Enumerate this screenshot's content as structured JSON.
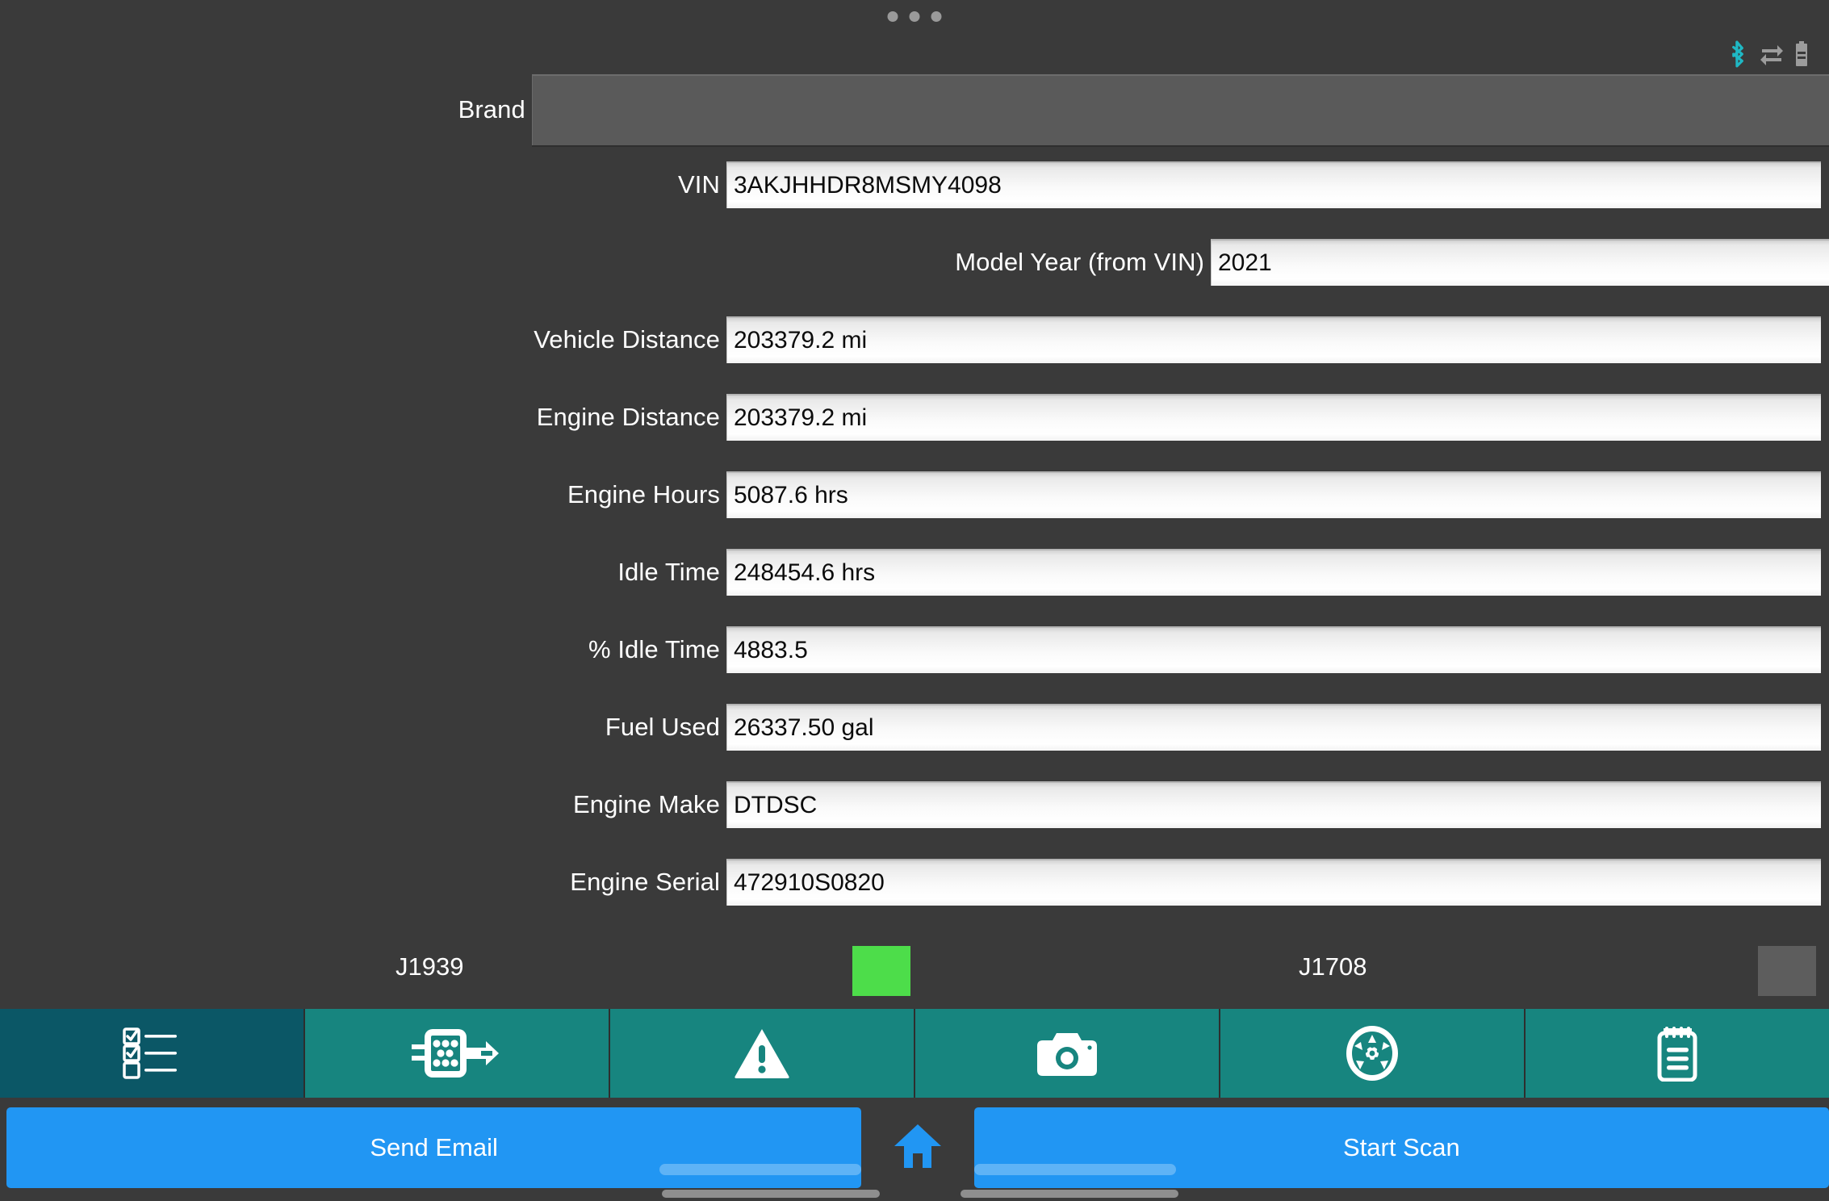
{
  "statusbar": {
    "dots_count": 3,
    "icons": [
      {
        "name": "bluetooth-icon",
        "color": "#1fb8c4"
      },
      {
        "name": "data-transfer-icon",
        "color": "#9c9c9c"
      },
      {
        "name": "battery-icon",
        "color": "#9c9c9c"
      }
    ]
  },
  "form": {
    "rows": [
      {
        "label": "Brand",
        "value": "",
        "type": "dropdown"
      },
      {
        "label": "VIN",
        "value": "3AKJHHDR8MSMY4098",
        "type": "text"
      },
      {
        "label": "Model Year (from VIN)",
        "value": "2021",
        "type": "text"
      },
      {
        "label": "Vehicle Distance",
        "value": "203379.2 mi",
        "type": "text"
      },
      {
        "label": "Engine Distance",
        "value": "203379.2 mi",
        "type": "text"
      },
      {
        "label": "Engine Hours",
        "value": "5087.6 hrs",
        "type": "text"
      },
      {
        "label": "Idle Time",
        "value": "248454.6 hrs",
        "type": "text"
      },
      {
        "label": "% Idle Time",
        "value": "4883.5",
        "type": "text"
      },
      {
        "label": "Fuel Used",
        "value": "26337.50 gal",
        "type": "text"
      },
      {
        "label": "Engine Make",
        "value": "DTDSC",
        "type": "text"
      },
      {
        "label": "Engine Serial",
        "value": "472910S0820",
        "type": "text"
      }
    ]
  },
  "protocols": [
    {
      "label": "J1939",
      "status": "active",
      "color": "#4ddd4a"
    },
    {
      "label": "J1708",
      "status": "inactive",
      "color": "#5d5d5d"
    }
  ],
  "tabs": [
    {
      "name": "checklist",
      "icon": "checklist-icon",
      "selected": true
    },
    {
      "name": "connector",
      "icon": "connector-plug-icon",
      "selected": false
    },
    {
      "name": "faults",
      "icon": "warning-triangle-icon",
      "selected": false
    },
    {
      "name": "camera",
      "icon": "camera-icon",
      "selected": false
    },
    {
      "name": "wheels",
      "icon": "wheel-icon",
      "selected": false
    },
    {
      "name": "notes",
      "icon": "notepad-icon",
      "selected": false
    }
  ],
  "actions": {
    "send_email_label": "Send Email",
    "start_scan_label": "Start Scan",
    "home_icon": "home-icon"
  },
  "colors": {
    "background": "#3a3a3a",
    "tab_active": "#0b5766",
    "tab_inactive": "#17857f",
    "button_blue": "#2196f3",
    "led_on": "#4ddd4a",
    "led_off": "#5d5d5d"
  }
}
